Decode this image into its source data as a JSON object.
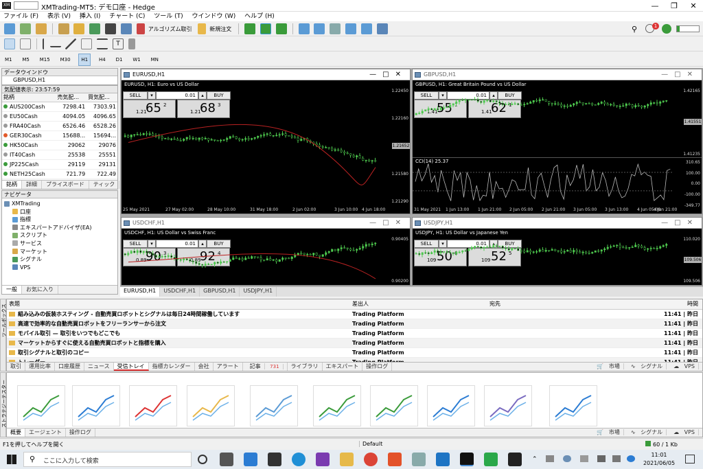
{
  "window": {
    "title": "XMTrading-MT5: デモ口座 - Hedge",
    "logo_text": "XM"
  },
  "menu": [
    "ファイル (F)",
    "表示 (V)",
    "挿入 (I)",
    "チャート (C)",
    "ツール (T)",
    "ウインドウ (W)",
    "ヘルプ (H)"
  ],
  "toolbar": {
    "algo_label": "アルゴリズム取引",
    "new_order_label": "新規注文",
    "notification_count": "1"
  },
  "timeframes": [
    "M1",
    "M5",
    "M15",
    "M30",
    "H1",
    "H4",
    "D1",
    "W1",
    "MN"
  ],
  "active_timeframe": "H1",
  "data_window": {
    "title": "データウインドウ",
    "symbol": "GBPUSD,H1"
  },
  "market_watch": {
    "title": "気配値表示: 23:57:59",
    "headers": [
      "銘柄",
      "売気配...",
      "買気配..."
    ],
    "rows": [
      {
        "symbol": "AUS200Cash",
        "bid": "7298.41",
        "ask": "7303.91",
        "color": "#3a9b3a"
      },
      {
        "symbol": "EU50Cash",
        "bid": "4094.05",
        "ask": "4096.65",
        "color": "#999999"
      },
      {
        "symbol": "FRA40Cash",
        "bid": "6526.46",
        "ask": "6528.26",
        "color": "#999999"
      },
      {
        "symbol": "GER30Cash",
        "bid": "15688...",
        "ask": "15694...",
        "color": "#e25a2a"
      },
      {
        "symbol": "HK50Cash",
        "bid": "29062",
        "ask": "29076",
        "color": "#3a9b3a"
      },
      {
        "symbol": "IT40Cash",
        "bid": "25538",
        "ask": "25551",
        "color": "#999999"
      },
      {
        "symbol": "JP225Cash",
        "bid": "29119",
        "ask": "29131",
        "color": "#3a9b3a"
      },
      {
        "symbol": "NETH25Cash",
        "bid": "721.79",
        "ask": "722.49",
        "color": "#3a9b3a"
      }
    ],
    "tabs": [
      "銘柄",
      "詳細",
      "プライスボード",
      "ティック"
    ]
  },
  "navigator": {
    "title": "ナビゲータ",
    "items": [
      "XMTrading",
      "口座",
      "指標",
      "エキスパートアドバイザ(EA)",
      "スクリプト",
      "サービス",
      "マーケット",
      "シグナル",
      "VPS"
    ],
    "tabs": [
      "一般",
      "お気に入り"
    ]
  },
  "charts": [
    {
      "title": "EURUSD,H1",
      "info": "EURUSD, H1:  Euro vs US Dollar",
      "sell": "SELL",
      "buy": "BUY",
      "lot": "0.01",
      "bid": {
        "prefix": "1.21",
        "big": "65",
        "sup": "2"
      },
      "ask": {
        "prefix": "1.21",
        "big": "68",
        "sup": "3"
      },
      "yticks": [
        "1.22450",
        "1.22160",
        "1.21870",
        "1.21580",
        "1.21290"
      ],
      "current": "1.21652",
      "xticks": [
        "25 May 2021",
        "27 May 02:00",
        "28 May 10:00",
        "31 May 18:00",
        "2 Jun 02:00",
        "3 Jun 10:00",
        "4 Jun 18:00"
      ]
    },
    {
      "title": "GBPUSD,H1",
      "info": "GBPUSD, H1:  Great Britain Pound vs US Dollar",
      "sell": "SELL",
      "buy": "BUY",
      "lot": "0.01",
      "bid": {
        "prefix": "1.41",
        "big": "55",
        "sup": "1"
      },
      "ask": {
        "prefix": "1.41",
        "big": "62",
        "sup": "1"
      },
      "yticks": [
        "1.42165",
        "1.41700",
        "1.41235"
      ],
      "current": "1.41551",
      "indicator": "CCI(14) 25.37",
      "indicator_ticks": [
        "310.65",
        "100.00",
        "0.00",
        "-100.00",
        "-349.77"
      ],
      "xticks": [
        "31 May 2021",
        "1 Jun 13:00",
        "1 Jun 21:00",
        "2 Jun 05:00",
        "2 Jun 21:00",
        "3 Jun 05:00",
        "3 Jun 13:00",
        "4 Jun 05:00",
        "4 Jun 21:00"
      ]
    },
    {
      "title": "USDCHF,H1",
      "info": "USDCHF, H1:  US Dollar vs Swiss Franc",
      "sell": "SELL",
      "buy": "BUY",
      "lot": "0.01",
      "bid": {
        "prefix": "0.89",
        "big": "90",
        "sup": "3"
      },
      "ask": {
        "prefix": "0.89",
        "big": "92",
        "sup": "4"
      },
      "yticks": [
        "0.90405",
        "0.90200"
      ]
    },
    {
      "title": "USDJPY,H1",
      "info": "USDJPY, H1:  US Dollar vs Japanese Yen",
      "sell": "SELL",
      "buy": "BUY",
      "lot": "0.01",
      "bid": {
        "prefix": "109",
        "big": "50",
        "sup": "6"
      },
      "ask": {
        "prefix": "109",
        "big": "52",
        "sup": "5"
      },
      "yticks": [
        "110.020",
        "109.506"
      ],
      "current": "109.506"
    }
  ],
  "chart_tabs": [
    "EURUSD,H1",
    "USDCHF,H1",
    "GBPUSD,H1",
    "USDJPY,H1"
  ],
  "toolbox": {
    "side_label": "ツールボックス",
    "headers": [
      "表題",
      "差出人",
      "宛先",
      "時間"
    ],
    "rows": [
      {
        "subject": "組み込みの仮装ホスティング - 自動売買ロボットとシグナルは毎日24時間稼働しています",
        "from": "Trading Platform",
        "time": "11:41 | 昨日"
      },
      {
        "subject": "高速で効率的な自動売買ロボットをフリーランサーから注文",
        "from": "Trading Platform",
        "time": "11:41 | 昨日"
      },
      {
        "subject": "モバイル取引 — 取引をいつでもどこでも",
        "from": "Trading Platform",
        "time": "11:41 | 昨日"
      },
      {
        "subject": "マーケットからすぐに使える自動売買ロボットと指標を購入",
        "from": "Trading Platform",
        "time": "11:41 | 昨日"
      },
      {
        "subject": "取引シグナルと取引のコピー",
        "from": "Trading Platform",
        "time": "11:41 | 昨日"
      },
      {
        "subject": "トレーダー...",
        "from": "Trading Platform",
        "time": "11:41 | 昨日"
      }
    ],
    "tabs": [
      "取引",
      "運用比率",
      "口座履歴",
      "ニュース",
      "受信トレイ",
      "指標カレンダー",
      "会社",
      "アラート",
      "記事",
      "ライブラリ",
      "エキスパート",
      "操作ログ"
    ],
    "article_count": "731",
    "right_links": [
      "市場",
      "シグナル",
      "VPS"
    ]
  },
  "tester": {
    "side_label": "ストラテジーテスター",
    "tabs": [
      "概要",
      "エージェント",
      "操作ログ"
    ],
    "right_links": [
      "市場",
      "シグナル",
      "VPS"
    ]
  },
  "status": {
    "help": "F1を押してヘルプを開く",
    "profile": "Default",
    "traffic": "60 / 1 Kb"
  },
  "taskbar": {
    "search": "ここに入力して検索",
    "time": "11:01",
    "date": "2021/06/05"
  }
}
